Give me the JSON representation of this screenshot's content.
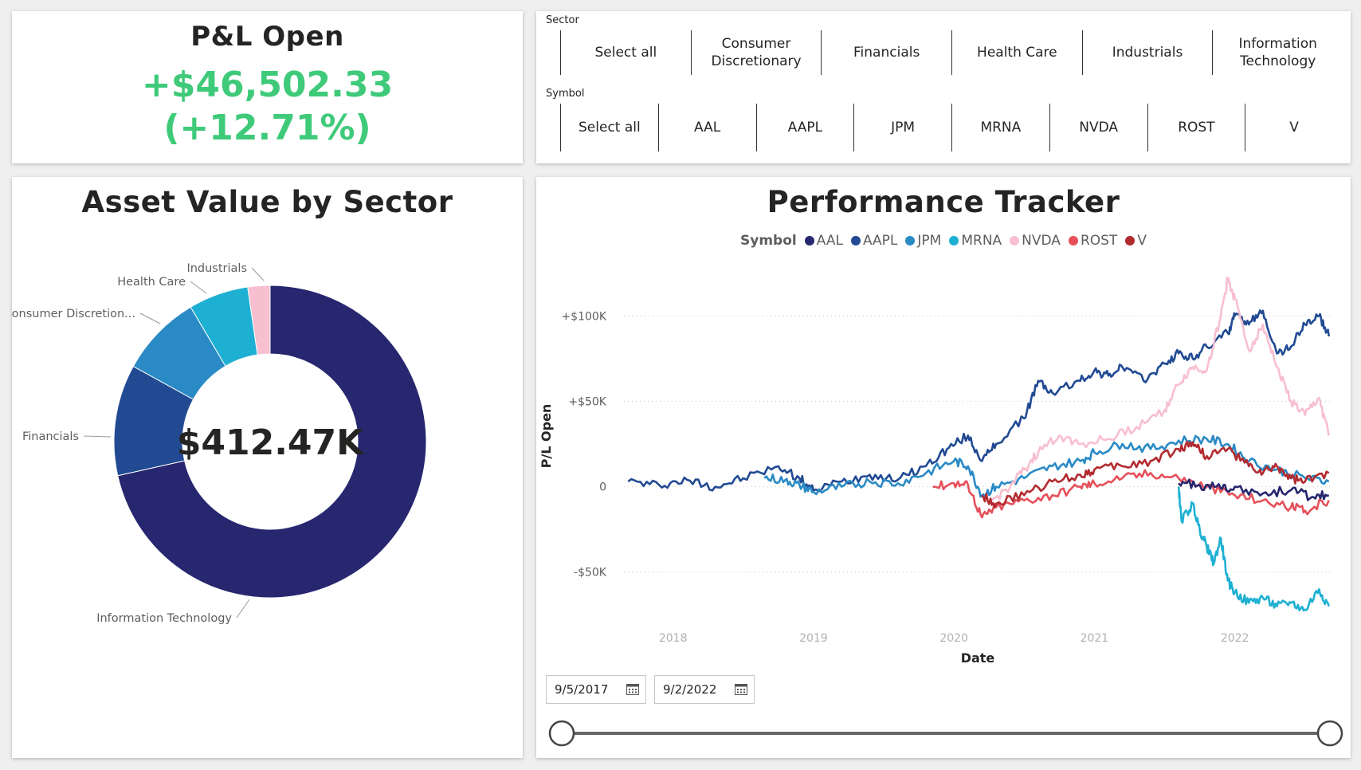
{
  "pl_card": {
    "title": "P&L Open",
    "value": "+$46,502.33",
    "pct": "(+12.71%)"
  },
  "slicers": {
    "sector": {
      "label": "Sector",
      "items": [
        "Select all",
        "Consumer\nDiscretionary",
        "Financials",
        "Health Care",
        "Industrials",
        "Information\nTechnology"
      ]
    },
    "symbol": {
      "label": "Symbol",
      "items": [
        "Select all",
        "AAL",
        "AAPL",
        "JPM",
        "MRNA",
        "NVDA",
        "ROST",
        "V"
      ]
    }
  },
  "donut": {
    "title": "Asset Value by Sector",
    "center_value": "$412.47K",
    "chart_data": {
      "type": "pie",
      "categories": [
        "Information Technology",
        "Financials",
        "Consumer Discretion...",
        "Health Care",
        "Industrials"
      ],
      "values": [
        71.5,
        11.5,
        8.5,
        6.2,
        2.3
      ],
      "colors": [
        "#26276f",
        "#214a93",
        "#2a8ac5",
        "#1eb0d3",
        "#f7bfcf"
      ]
    }
  },
  "perf": {
    "title": "Performance Tracker",
    "legend_title": "Symbol",
    "legend": [
      {
        "name": "AAL",
        "color": "#26276f"
      },
      {
        "name": "AAPL",
        "color": "#214a93"
      },
      {
        "name": "JPM",
        "color": "#2a8ac5"
      },
      {
        "name": "MRNA",
        "color": "#1eb0d3"
      },
      {
        "name": "NVDA",
        "color": "#f7bfcf"
      },
      {
        "name": "ROST",
        "color": "#e6505a"
      },
      {
        "name": "V",
        "color": "#b22b30"
      }
    ],
    "chart_data": {
      "type": "line",
      "xlabel": "Date",
      "ylabel": "P/L Open",
      "ylim": [
        -80000,
        130000
      ],
      "xlim": [
        2017.65,
        2022.7
      ],
      "y_ticks": [
        {
          "v": 100000,
          "label": "+$100K"
        },
        {
          "v": 50000,
          "label": "+$50K"
        },
        {
          "v": 0,
          "label": "0"
        },
        {
          "v": -50000,
          "label": "-$50K"
        }
      ],
      "x_ticks": [
        {
          "v": 2018,
          "label": "2018"
        },
        {
          "v": 2019,
          "label": "2019"
        },
        {
          "v": 2020,
          "label": "2020"
        },
        {
          "v": 2021,
          "label": "2021"
        },
        {
          "v": 2022,
          "label": "2022"
        }
      ],
      "series": [
        {
          "name": "AAPL",
          "color": "#214a93",
          "points": [
            [
              2017.68,
              3000
            ],
            [
              2017.9,
              1000
            ],
            [
              2018.1,
              4000
            ],
            [
              2018.3,
              0
            ],
            [
              2018.5,
              5000
            ],
            [
              2018.75,
              12000
            ],
            [
              2018.9,
              5000
            ],
            [
              2019.0,
              -2000
            ],
            [
              2019.2,
              3000
            ],
            [
              2019.4,
              7000
            ],
            [
              2019.6,
              4000
            ],
            [
              2019.8,
              12000
            ],
            [
              2019.95,
              22000
            ],
            [
              2020.1,
              30000
            ],
            [
              2020.2,
              15000
            ],
            [
              2020.3,
              25000
            ],
            [
              2020.5,
              40000
            ],
            [
              2020.6,
              62000
            ],
            [
              2020.7,
              55000
            ],
            [
              2020.9,
              62000
            ],
            [
              2021.0,
              68000
            ],
            [
              2021.1,
              65000
            ],
            [
              2021.2,
              70000
            ],
            [
              2021.35,
              62000
            ],
            [
              2021.5,
              72000
            ],
            [
              2021.6,
              78000
            ],
            [
              2021.7,
              75000
            ],
            [
              2021.8,
              82000
            ],
            [
              2021.95,
              90000
            ],
            [
              2022.0,
              100000
            ],
            [
              2022.1,
              95000
            ],
            [
              2022.2,
              103000
            ],
            [
              2022.3,
              78000
            ],
            [
              2022.4,
              82000
            ],
            [
              2022.5,
              95000
            ],
            [
              2022.6,
              100000
            ],
            [
              2022.67,
              88000
            ]
          ]
        },
        {
          "name": "JPM",
          "color": "#2a8ac5",
          "points": [
            [
              2018.65,
              5000
            ],
            [
              2018.8,
              4000
            ],
            [
              2018.9,
              1000
            ],
            [
              2019.0,
              -3000
            ],
            [
              2019.2,
              0
            ],
            [
              2019.4,
              3000
            ],
            [
              2019.6,
              2000
            ],
            [
              2019.8,
              8000
            ],
            [
              2020.0,
              15000
            ],
            [
              2020.1,
              12000
            ],
            [
              2020.2,
              -5000
            ],
            [
              2020.3,
              0
            ],
            [
              2020.5,
              5000
            ],
            [
              2020.7,
              12000
            ],
            [
              2020.9,
              15000
            ],
            [
              2021.0,
              20000
            ],
            [
              2021.2,
              25000
            ],
            [
              2021.4,
              22000
            ],
            [
              2021.6,
              27000
            ],
            [
              2021.8,
              28000
            ],
            [
              2021.95,
              25000
            ],
            [
              2022.1,
              15000
            ],
            [
              2022.3,
              10000
            ],
            [
              2022.5,
              5000
            ],
            [
              2022.67,
              3000
            ]
          ]
        },
        {
          "name": "MRNA",
          "color": "#1eb0d3",
          "points": [
            [
              2021.6,
              0
            ],
            [
              2021.62,
              -20000
            ],
            [
              2021.7,
              -10000
            ],
            [
              2021.75,
              -25000
            ],
            [
              2021.8,
              -35000
            ],
            [
              2021.85,
              -45000
            ],
            [
              2021.9,
              -30000
            ],
            [
              2021.95,
              -55000
            ],
            [
              2022.0,
              -62000
            ],
            [
              2022.1,
              -68000
            ],
            [
              2022.2,
              -65000
            ],
            [
              2022.3,
              -70000
            ],
            [
              2022.4,
              -68000
            ],
            [
              2022.5,
              -72000
            ],
            [
              2022.6,
              -60000
            ],
            [
              2022.67,
              -70000
            ]
          ]
        },
        {
          "name": "NVDA",
          "color": "#f7bfcf",
          "points": [
            [
              2020.25,
              -10000
            ],
            [
              2020.4,
              0
            ],
            [
              2020.5,
              10000
            ],
            [
              2020.6,
              20000
            ],
            [
              2020.75,
              30000
            ],
            [
              2020.9,
              25000
            ],
            [
              2021.1,
              28000
            ],
            [
              2021.3,
              35000
            ],
            [
              2021.5,
              45000
            ],
            [
              2021.6,
              60000
            ],
            [
              2021.7,
              70000
            ],
            [
              2021.8,
              68000
            ],
            [
              2021.9,
              100000
            ],
            [
              2021.95,
              122000
            ],
            [
              2022.0,
              110000
            ],
            [
              2022.1,
              80000
            ],
            [
              2022.2,
              95000
            ],
            [
              2022.3,
              70000
            ],
            [
              2022.4,
              50000
            ],
            [
              2022.5,
              42000
            ],
            [
              2022.6,
              52000
            ],
            [
              2022.67,
              30000
            ]
          ]
        },
        {
          "name": "ROST",
          "color": "#e6505a",
          "points": [
            [
              2019.85,
              0
            ],
            [
              2020.0,
              2000
            ],
            [
              2020.1,
              1000
            ],
            [
              2020.2,
              -18000
            ],
            [
              2020.3,
              -12000
            ],
            [
              2020.5,
              -8000
            ],
            [
              2020.7,
              -5000
            ],
            [
              2020.9,
              0
            ],
            [
              2021.0,
              2000
            ],
            [
              2021.2,
              5000
            ],
            [
              2021.4,
              8000
            ],
            [
              2021.6,
              5000
            ],
            [
              2021.8,
              0
            ],
            [
              2022.0,
              -5000
            ],
            [
              2022.2,
              -8000
            ],
            [
              2022.4,
              -12000
            ],
            [
              2022.5,
              -14000
            ],
            [
              2022.67,
              -8000
            ]
          ]
        },
        {
          "name": "V",
          "color": "#b22b30",
          "points": [
            [
              2020.2,
              -5000
            ],
            [
              2020.3,
              -10000
            ],
            [
              2020.5,
              -5000
            ],
            [
              2020.7,
              3000
            ],
            [
              2020.9,
              7000
            ],
            [
              2021.0,
              10000
            ],
            [
              2021.2,
              12000
            ],
            [
              2021.4,
              15000
            ],
            [
              2021.6,
              22000
            ],
            [
              2021.7,
              26000
            ],
            [
              2021.8,
              18000
            ],
            [
              2021.95,
              22000
            ],
            [
              2022.1,
              12000
            ],
            [
              2022.2,
              8000
            ],
            [
              2022.3,
              12000
            ],
            [
              2022.4,
              5000
            ],
            [
              2022.5,
              3000
            ],
            [
              2022.67,
              8000
            ]
          ]
        },
        {
          "name": "AAL",
          "color": "#26276f",
          "points": [
            [
              2021.6,
              2000
            ],
            [
              2021.75,
              1000
            ],
            [
              2021.9,
              -1000
            ],
            [
              2022.0,
              0
            ],
            [
              2022.2,
              -4000
            ],
            [
              2022.4,
              -2000
            ],
            [
              2022.55,
              -6000
            ],
            [
              2022.67,
              -5000
            ]
          ]
        }
      ]
    },
    "date_from": "9/5/2017",
    "date_to": "9/2/2022"
  }
}
